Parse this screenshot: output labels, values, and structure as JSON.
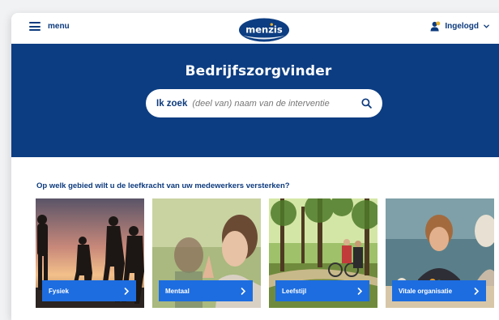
{
  "header": {
    "menu_label": "menu",
    "logo_text": "menzis",
    "user_label": "Ingelogd"
  },
  "hero": {
    "title": "Bedrijfszorgvinder",
    "search": {
      "label": "Ik zoek",
      "placeholder": "(deel van) naam van de interventie"
    }
  },
  "section": {
    "question": "Op welk gebied wilt u de leefkracht van uw medewerkers versterken?"
  },
  "cards": [
    {
      "label": "Fysiek"
    },
    {
      "label": "Mentaal"
    },
    {
      "label": "Leefstijl"
    },
    {
      "label": "Vitale organisatie"
    }
  ],
  "colors": {
    "brand_navy": "#0c3d82",
    "button_blue": "#1d6de0",
    "text_navy": "#0c3a7d",
    "logo_accent": "#e8b02a"
  },
  "icons": {
    "menu": "hamburger-icon",
    "user": "user-icon",
    "dropdown": "chevron-down-icon",
    "search": "search-icon",
    "card_arrow": "chevron-right-icon"
  }
}
